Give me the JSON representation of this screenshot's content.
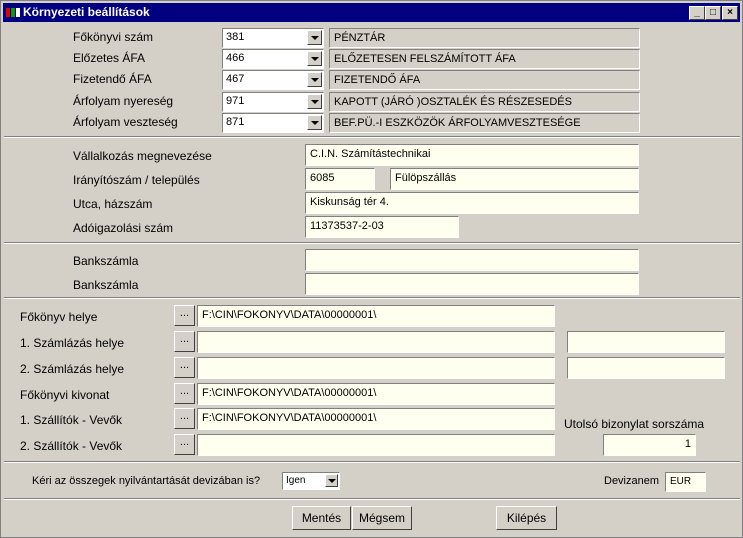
{
  "window": {
    "title": "Környezeti beállítások"
  },
  "accounts": [
    {
      "label": "Főkönyvi szám",
      "code": "381",
      "desc": "PÉNZTÁR"
    },
    {
      "label": "Előzetes ÁFA",
      "code": "466",
      "desc": "ELŐZETESEN FELSZÁMÍTOTT ÁFA"
    },
    {
      "label": "Fizetendő ÁFA",
      "code": "467",
      "desc": "FIZETENDŐ ÁFA"
    },
    {
      "label": "Árfolyam nyereség",
      "code": "971",
      "desc": "KAPOTT (JÁRÓ )OSZTALÉK ÉS RÉSZESEDÉS"
    },
    {
      "label": "Árfolyam veszteség",
      "code": "871",
      "desc": "BEF.PÜ.-I ESZKÖZÖK ÁRFOLYAMVESZTESÉGE"
    }
  ],
  "company": {
    "name_label": "Vállalkozás megnevezése",
    "name": "C.I.N. Számítástechnikai",
    "zip_city_label": "Irányítószám / település",
    "zip": "6085",
    "city": "Fülöpszállás",
    "street_label": "Utca, házszám",
    "street": "Kiskunság tér 4.",
    "tax_label": "Adóigazolási szám",
    "tax": "11373537-2-03"
  },
  "bank": [
    {
      "label": "Bankszámla",
      "value": ""
    },
    {
      "label": "Bankszámla",
      "value": ""
    }
  ],
  "paths": [
    {
      "label": "Főkönyv helye",
      "value": "F:\\CIN\\FOKONYV\\DATA\\00000001\\"
    },
    {
      "label": "1. Számlázás helye",
      "value": "",
      "extra": ""
    },
    {
      "label": "2. Számlázás helye",
      "value": "",
      "extra": ""
    },
    {
      "label": "Főkönyvi kivonat",
      "value": "F:\\CIN\\FOKONYV\\DATA\\00000001\\"
    },
    {
      "label": "1. Szállítók - Vevők",
      "value": "F:\\CIN\\FOKONYV\\DATA\\00000001\\"
    },
    {
      "label": "2. Szállítók - Vevők",
      "value": ""
    }
  ],
  "browse_label": "...",
  "last_doc": {
    "label": "Utolsó bizonylat sorszáma",
    "value": "1"
  },
  "currency": {
    "question": "Kéri az összegek nyilvántartását devizában is?",
    "selected": "Igen",
    "name_label": "Devizanem",
    "name": "EUR"
  },
  "buttons": {
    "save": "Mentés",
    "cancel": "Mégsem",
    "exit": "Kilépés"
  }
}
